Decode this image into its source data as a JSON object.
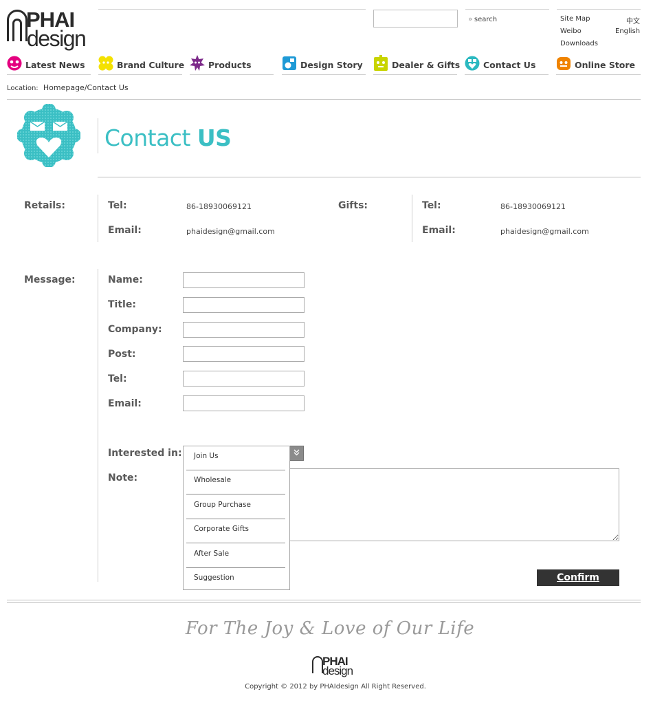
{
  "brand": {
    "logo_top": "PHAI",
    "logo_bottom": "design"
  },
  "header": {
    "search_placeholder": "",
    "search_label": "search",
    "links": {
      "site_map": "Site Map",
      "chinese": "中文",
      "weibo": "Weibo",
      "english": "English",
      "downloads": "Downloads"
    }
  },
  "nav": [
    {
      "label": "Latest News",
      "icon": "pink-face-icon",
      "color": "#e4007f"
    },
    {
      "label": "Brand Culture",
      "icon": "yellow-flower-icon",
      "color": "#f4e100"
    },
    {
      "label": "Products",
      "icon": "purple-star-icon",
      "color": "#7d2a8a"
    },
    {
      "label": "Design Story",
      "icon": "blue-square-icon",
      "color": "#1f9ad6"
    },
    {
      "label": "Dealer & Gifts",
      "icon": "lime-gift-icon",
      "color": "#c8d400"
    },
    {
      "label": "Contact Us",
      "icon": "teal-heart-icon",
      "color": "#2bb9c0"
    },
    {
      "label": "Online Store",
      "icon": "orange-cart-icon",
      "color": "#f08300"
    }
  ],
  "location": {
    "label": "Location:",
    "path": "Homepage/Contact Us"
  },
  "title": {
    "light": "Contact ",
    "bold": "US"
  },
  "retails": {
    "label": "Retails:",
    "tel_label": "Tel:",
    "tel": "86-18930069121",
    "email_label": "Email:",
    "email": "phaidesign@gmail.com"
  },
  "gifts": {
    "label": "Gifts:",
    "tel_label": "Tel:",
    "tel": "86-18930069121",
    "email_label": "Email:",
    "email": "phaidesign@gmail.com"
  },
  "message": {
    "label": "Message:",
    "fields": {
      "name": "Name:",
      "title": "Title:",
      "company": "Company:",
      "post": "Post:",
      "tel": "Tel:",
      "email": "Email:"
    },
    "interested_label": "Interested in:",
    "options": [
      "Join Us",
      "Wholesale",
      "Group Purchase",
      "Corporate Gifts",
      "After Sale",
      "Suggestion"
    ],
    "note_label": "Note:",
    "confirm": "Confirm"
  },
  "footer": {
    "slogan": "For The Joy & Love of Our Life",
    "copyright": "Copyright © 2012 by PHAIdesign All Right Reserved."
  }
}
